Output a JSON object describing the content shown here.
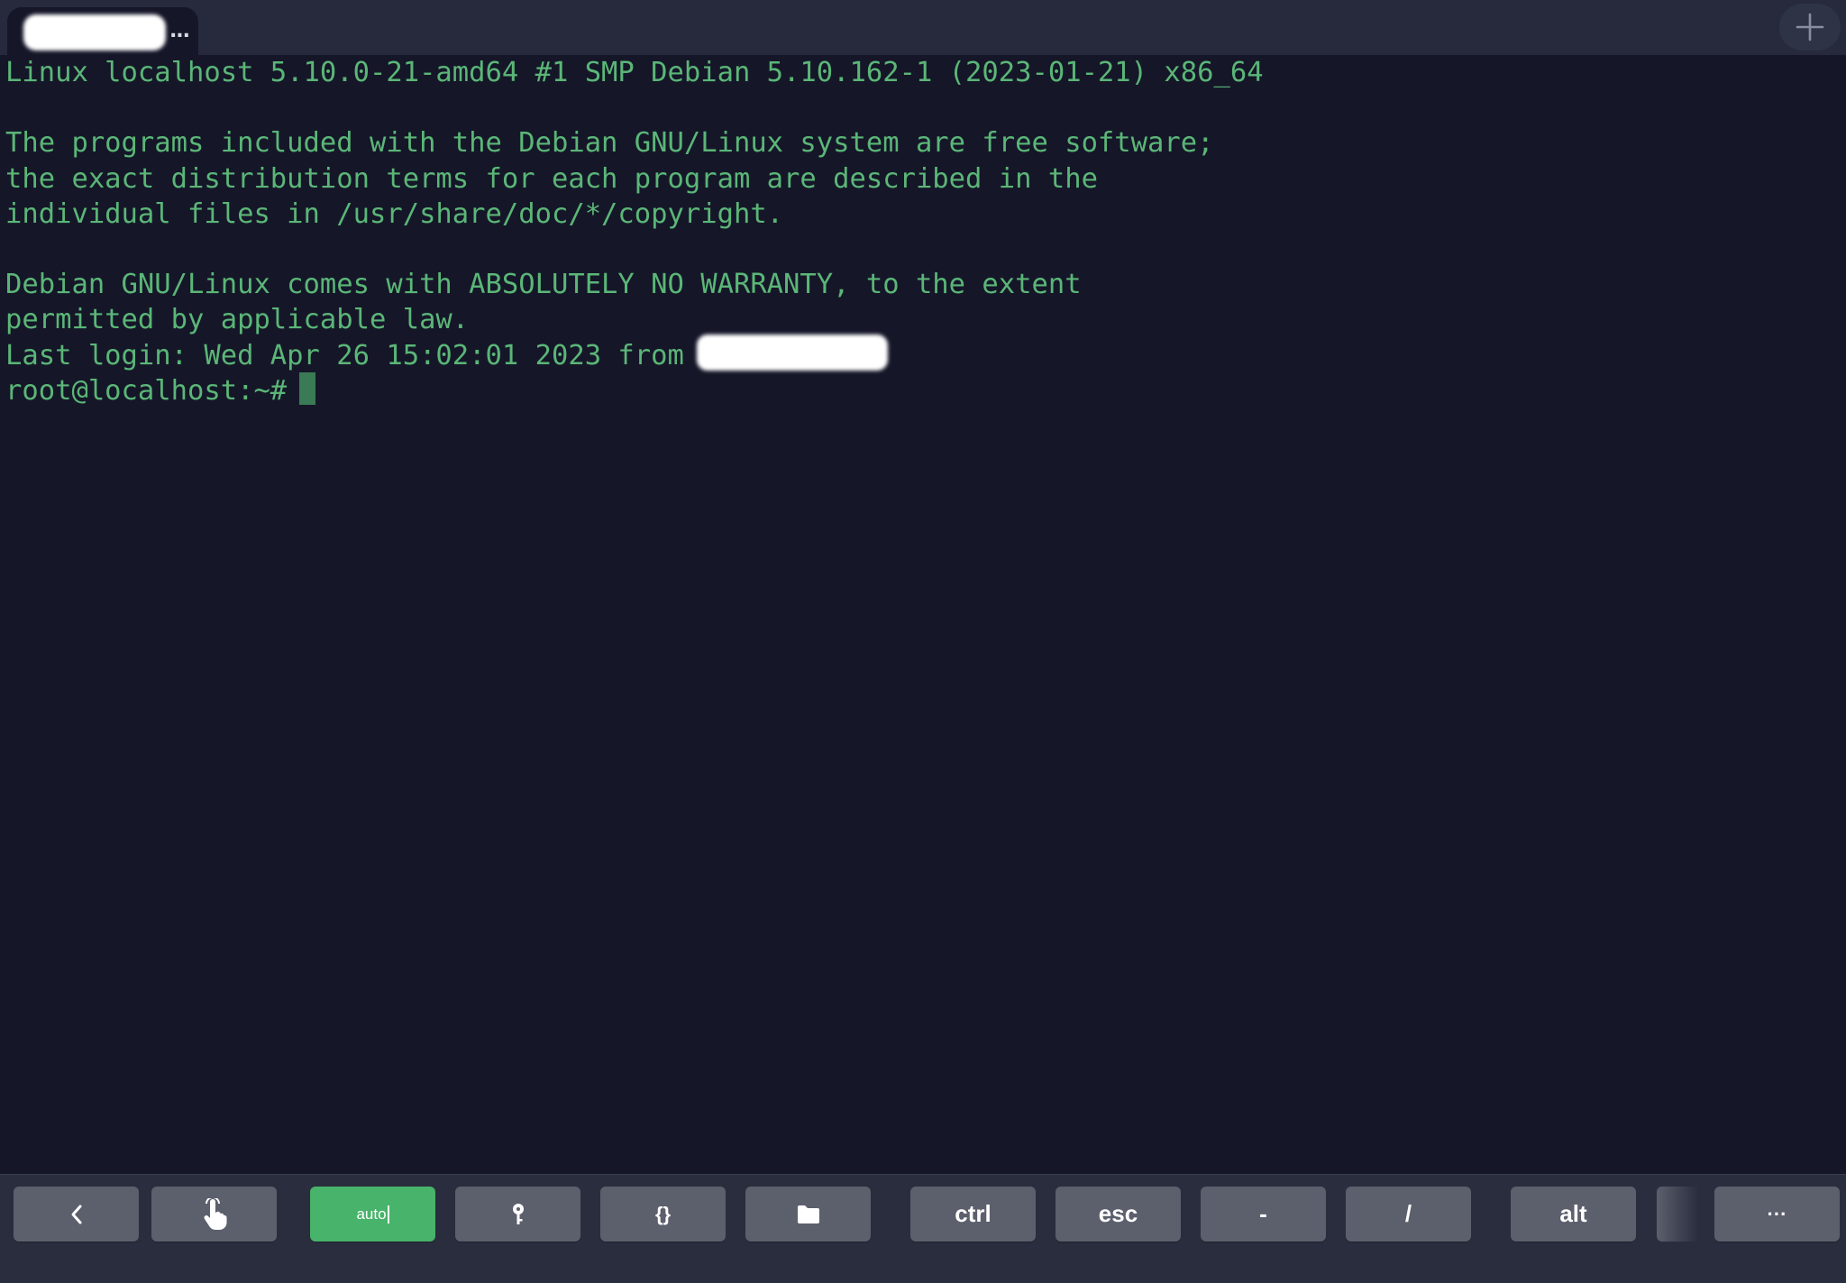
{
  "tabbar": {
    "active_tab": {
      "more_label": "...",
      "more_icon": "ellipsis-icon"
    },
    "new_tab_icon": "plus-icon"
  },
  "terminal": {
    "text_color": "#5bb677",
    "background": "#151729",
    "lines": [
      "Linux localhost 5.10.0-21-amd64 #1 SMP Debian 5.10.162-1 (2023-01-21) x86_64",
      "",
      "The programs included with the Debian GNU/Linux system are free software;",
      "the exact distribution terms for each program are described in the",
      "individual files in /usr/share/doc/*/copyright.",
      "",
      "Debian GNU/Linux comes with ABSOLUTELY NO WARRANTY, to the extent",
      "permitted by applicable law."
    ],
    "last_login": "Last login: Wed Apr 26 15:02:01 2023 from",
    "prompt": "root@localhost:~#"
  },
  "keybar": {
    "back_icon": "chevron-left-icon",
    "touch_icon": "hand-pointer-icon",
    "auto_label": "auto",
    "key_icon": "key-icon",
    "snippets_label": "{}",
    "folder_icon": "folder-icon",
    "ctrl_label": "ctrl",
    "esc_label": "esc",
    "dash_label": "-",
    "slash_label": "/",
    "alt_label": "alt",
    "more_label": "···",
    "accent_color": "#48b36a",
    "key_color": "#5c5f6c"
  }
}
